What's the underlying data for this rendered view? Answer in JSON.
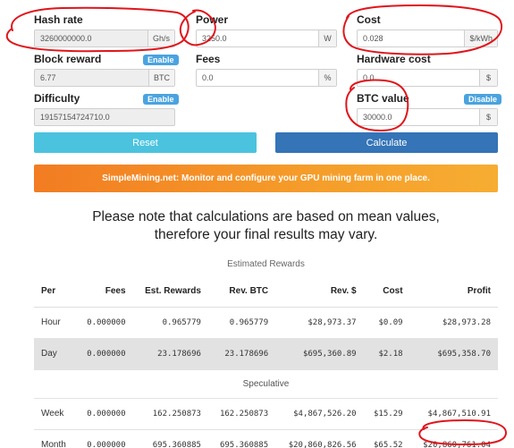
{
  "fields": {
    "hash_rate": {
      "label": "Hash rate",
      "value": "3260000000.0",
      "unit": "Gh/s"
    },
    "power": {
      "label": "Power",
      "value": "3250.0",
      "unit": "W"
    },
    "cost": {
      "label": "Cost",
      "value": "0.028",
      "unit": "$/kWh"
    },
    "block_reward": {
      "label": "Block reward",
      "badge": "Enable",
      "value": "6.77",
      "unit": "BTC"
    },
    "fees": {
      "label": "Fees",
      "value": "0.0",
      "unit": "%"
    },
    "hardware_cost": {
      "label": "Hardware cost",
      "value": "0.0",
      "unit": "$"
    },
    "difficulty": {
      "label": "Difficulty",
      "badge": "Enable",
      "value": "19157154724710.0"
    },
    "btc_value": {
      "label": "BTC value",
      "badge": "Disable",
      "value": "30000.0",
      "unit": "$"
    }
  },
  "buttons": {
    "reset": "Reset",
    "calculate": "Calculate"
  },
  "banner": "SimpleMining.net: Monitor and configure your GPU mining farm in one place.",
  "note_line1": "Please note that calculations are based on mean values,",
  "note_line2": "therefore your final results may vary.",
  "table": {
    "caption": "Estimated Rewards",
    "headers": [
      "Per",
      "Fees",
      "Est. Rewards",
      "Rev. BTC",
      "Rev. $",
      "Cost",
      "Profit"
    ],
    "rows": [
      [
        "Hour",
        "0.000000",
        "0.965779",
        "0.965779",
        "$28,973.37",
        "$0.09",
        "$28,973.28"
      ],
      [
        "Day",
        "0.000000",
        "23.178696",
        "23.178696",
        "$695,360.89",
        "$2.18",
        "$695,358.70"
      ]
    ],
    "speculative_label": "Speculative",
    "speculative_rows": [
      [
        "Week",
        "0.000000",
        "162.250873",
        "162.250873",
        "$4,867,526.20",
        "$15.29",
        "$4,867,510.91"
      ],
      [
        "Month",
        "0.000000",
        "695.360885",
        "695.360885",
        "$20,860,826.56",
        "$65.52",
        "$20,860,761.04"
      ]
    ]
  },
  "colors": {
    "annotation_red": "#e0151b",
    "reset_button": "#4bc3df",
    "calculate_button": "#3474b7",
    "badge": "#4aa3df",
    "banner_start": "#f27c22",
    "banner_end": "#f6ad32"
  }
}
